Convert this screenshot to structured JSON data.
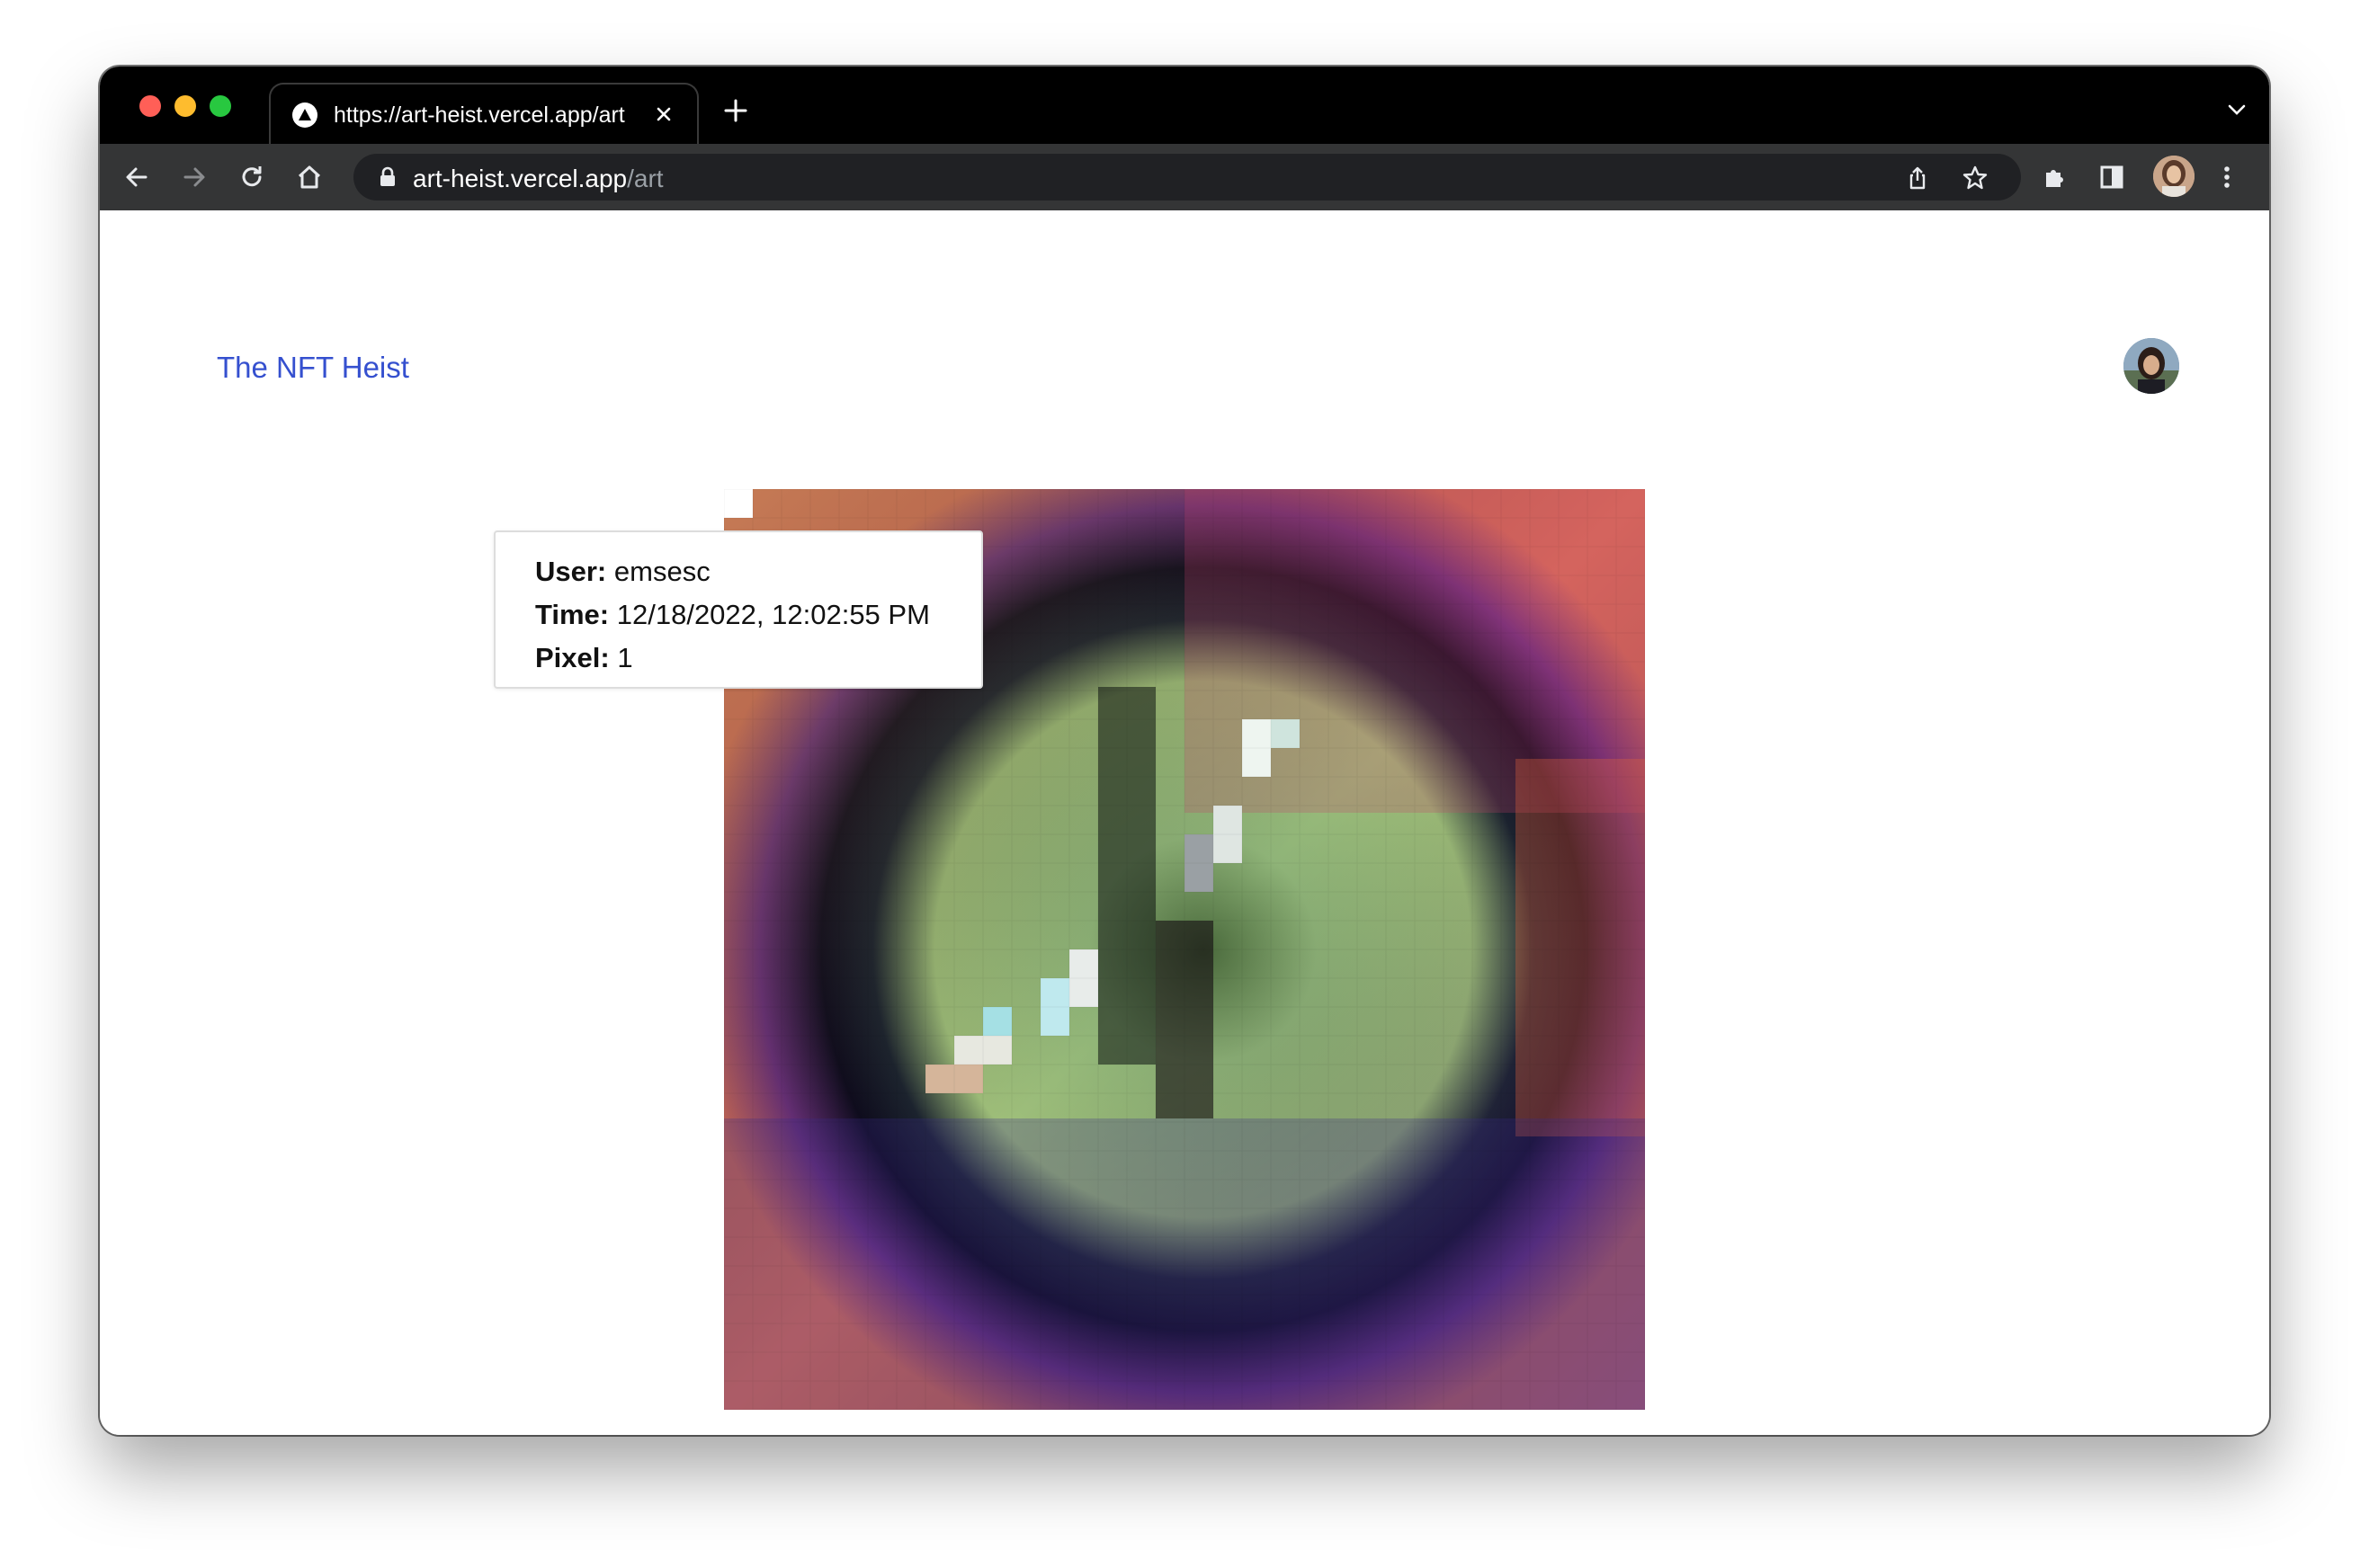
{
  "browser": {
    "tab_title": "https://art-heist.vercel.app/art",
    "url_host": "art-heist.vercel.app",
    "url_path": "/art",
    "icons": [
      "back-icon",
      "forward-icon",
      "reload-icon",
      "home-icon",
      "lock-icon",
      "share-icon",
      "bookmark-star-icon",
      "extensions-icon",
      "side-panel-icon",
      "profile-avatar",
      "more-menu-icon",
      "new-tab-icon",
      "tab-close-icon",
      "tab-list-icon"
    ]
  },
  "header": {
    "site_title": "The NFT Heist"
  },
  "tooltip": {
    "user_label": "User:",
    "user_value": "emsesc",
    "time_label": "Time:",
    "time_value": "12/18/2022, 12:02:55 PM",
    "pixel_label": "Pixel:",
    "pixel_value": "1"
  },
  "colors": {
    "link": "#3550cf",
    "titlebar": "#000000",
    "toolbar": "#343536",
    "omnibox": "#202124"
  }
}
